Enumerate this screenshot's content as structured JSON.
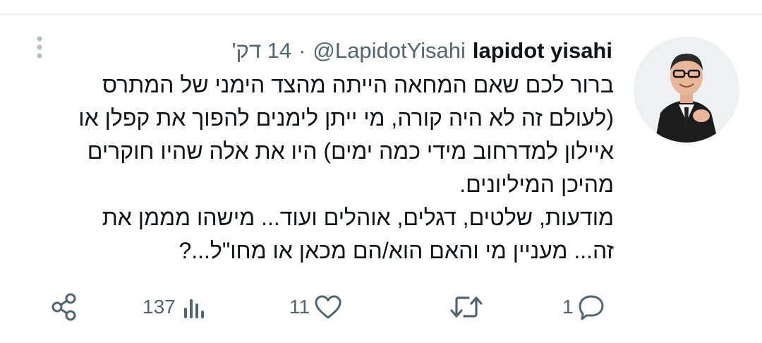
{
  "tweet": {
    "author_name": "lapidot yisahi",
    "handle": "@LapidotYisahi",
    "separator": "·",
    "time": "14 דק'",
    "text_lines": [
      "ברור לכם שאם המחאה הייתה מהצד הימני של המתרס",
      "(לעולם זה לא היה קורה, מי ייתן לימנים להפוך את קפלן או",
      "איילון למדרחוב מידי כמה ימים) היו את אלה שהיו חוקרים",
      "מהיכן המיליונים.",
      "מודעות, שלטים, דגלים, אוהלים ועוד... מישהו מממן את",
      "זה... מעניין מי והאם הוא/הם מכאן או מחו\"ל...?"
    ]
  },
  "actions": {
    "reply_count": "1",
    "retweet_count": "",
    "like_count": "11",
    "views_count": "137"
  },
  "icons": {
    "avatar": "profile-photo",
    "more": "more-vertical-icon",
    "reply": "comment-icon",
    "retweet": "retweet-icon",
    "like": "heart-icon",
    "views": "analytics-icon",
    "share": "share-icon"
  },
  "colors": {
    "text": "#0f1419",
    "secondary": "#536471",
    "more_icon": "#b4bfc6"
  }
}
